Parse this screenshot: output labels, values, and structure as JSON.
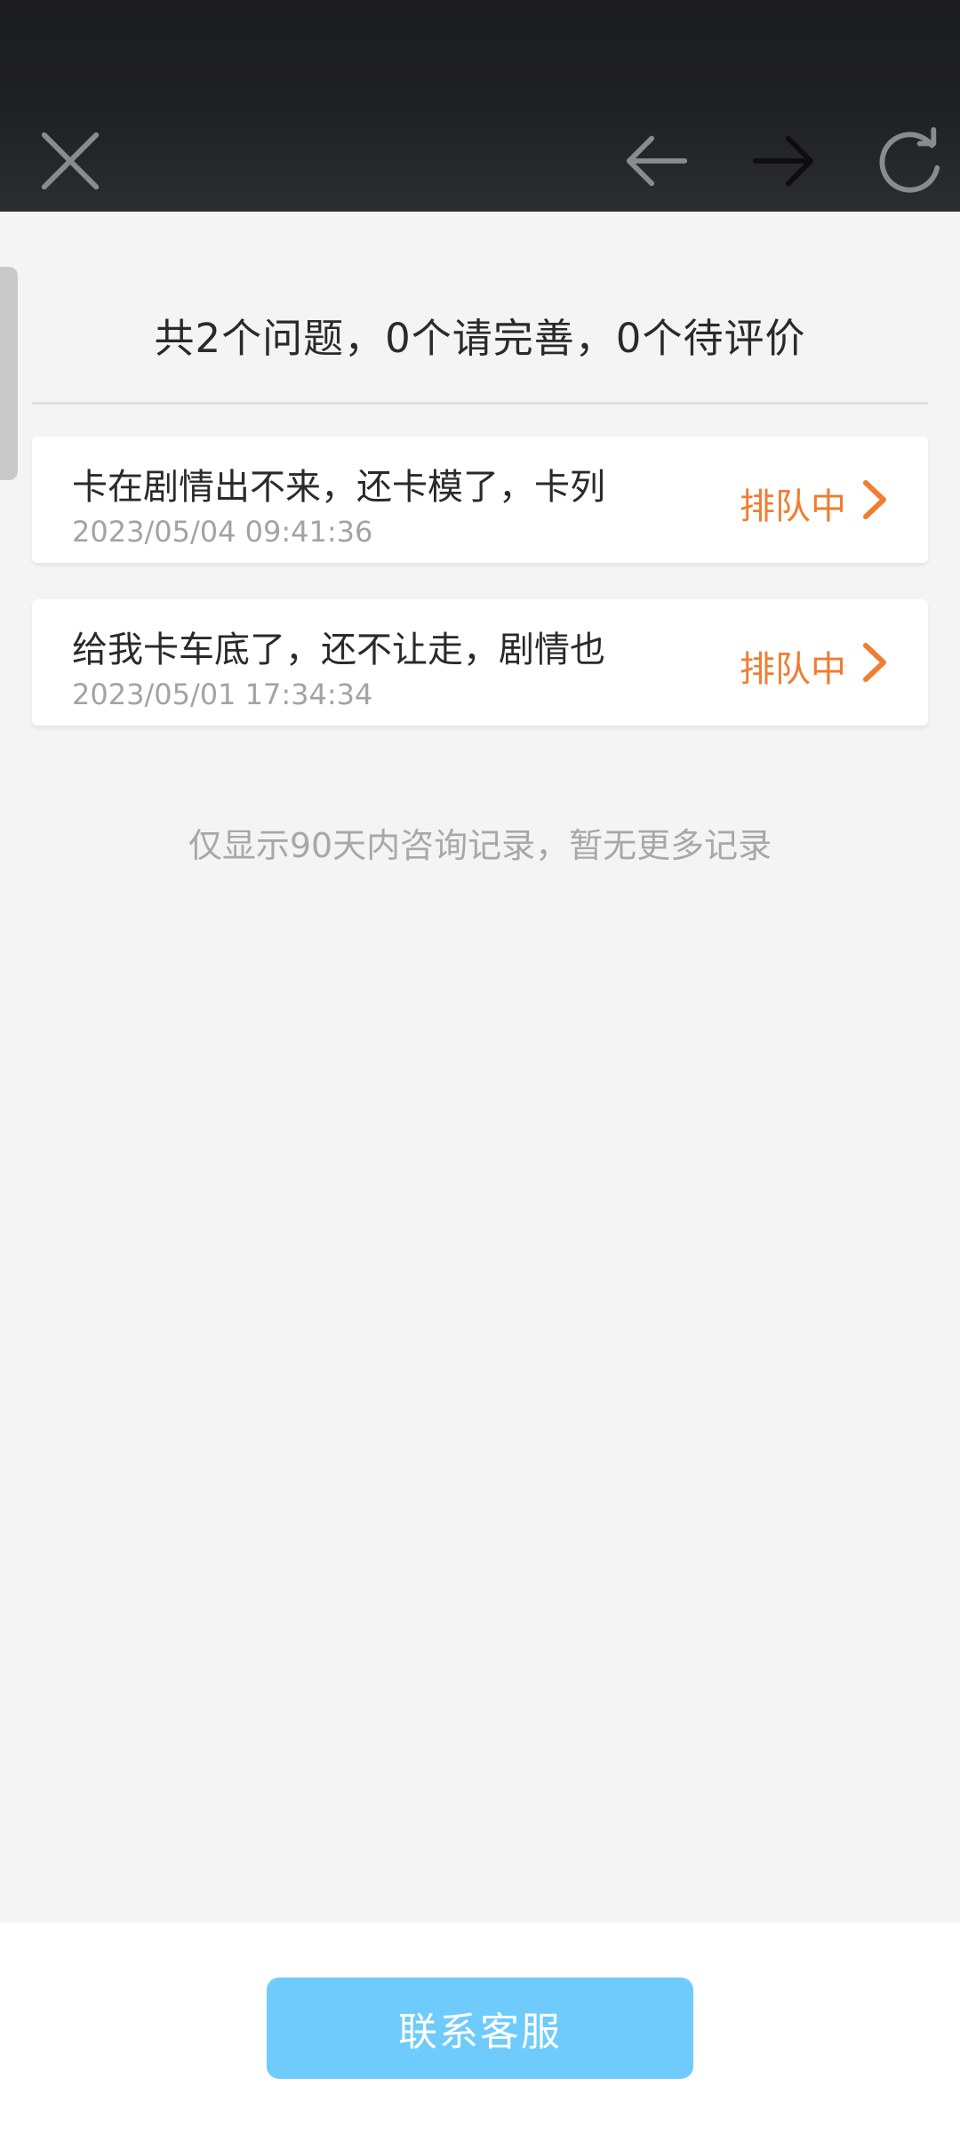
{
  "toolbar": {
    "close_icon": "close-icon",
    "back_icon": "arrow-left-icon",
    "forward_icon": "arrow-right-icon",
    "refresh_icon": "refresh-icon"
  },
  "summary": "共2个问题，0个请完善，0个待评价",
  "tickets": [
    {
      "title": "卡在剧情出不来，还卡模了，卡列",
      "time": "2023/05/04 09:41:36",
      "status": "排队中"
    },
    {
      "title": "给我卡车底了，还不让走，剧情也",
      "time": "2023/05/01 17:34:34",
      "status": "排队中"
    }
  ],
  "footnote": "仅显示90天内咨询记录，暂无更多记录",
  "contact_button": "联系客服",
  "colors": {
    "status": "#f07d31",
    "button": "#6ecbfb",
    "toolbar": "#1f2024"
  }
}
